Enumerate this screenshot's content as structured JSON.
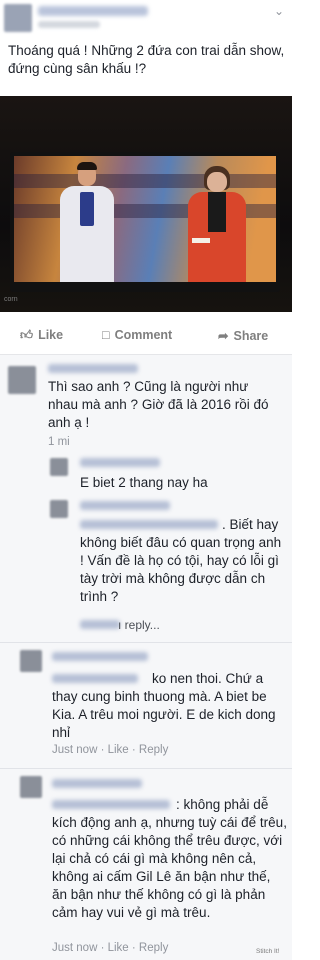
{
  "post": {
    "menu_icon": "chevron-down-icon",
    "text": "Thoáng quá ! Những 2 đứa con trai dẫn show, đứng cùng sân khấu !?",
    "photo_caption": "corn"
  },
  "actions": {
    "like": "Like",
    "comment": "Comment",
    "share": "Share"
  },
  "comments": [
    {
      "text": "Thì sao anh ? Cũng là người như nhau mà anh ? Giờ đã là 2016 rồi đó anh ạ !",
      "meta": "1 mi",
      "replies": [
        {
          "text": "E biet 2 thang nay ha"
        },
        {
          "text": ". Biết hay không biết đâu có quan trọng anh ! Vấn đề là họ có tội, hay có lỗi gì tày trời mà không được dẫn ch trình ?"
        }
      ],
      "more_replies": "ı reply..."
    },
    {
      "text": "ko nen thoi. Chứ a thay cung binh thuong mà. A biet be Kia. A trêu moi người. E de kich dong nhỉ",
      "meta": "Just now · Like · Reply"
    },
    {
      "text": ": không phải dễ kích động anh ạ, nhưng tuỳ cái để trêu, có những cái không thể trêu được, với lại chả có cái gì mà không nên cả, không ai cấm Gil Lê ăn bận như thế, ăn bận như thế không có gì là phản cảm hay vui vẻ gì mà trêu.",
      "meta": "Just now · Like · Reply"
    }
  ],
  "watermark": "Stitch It!"
}
